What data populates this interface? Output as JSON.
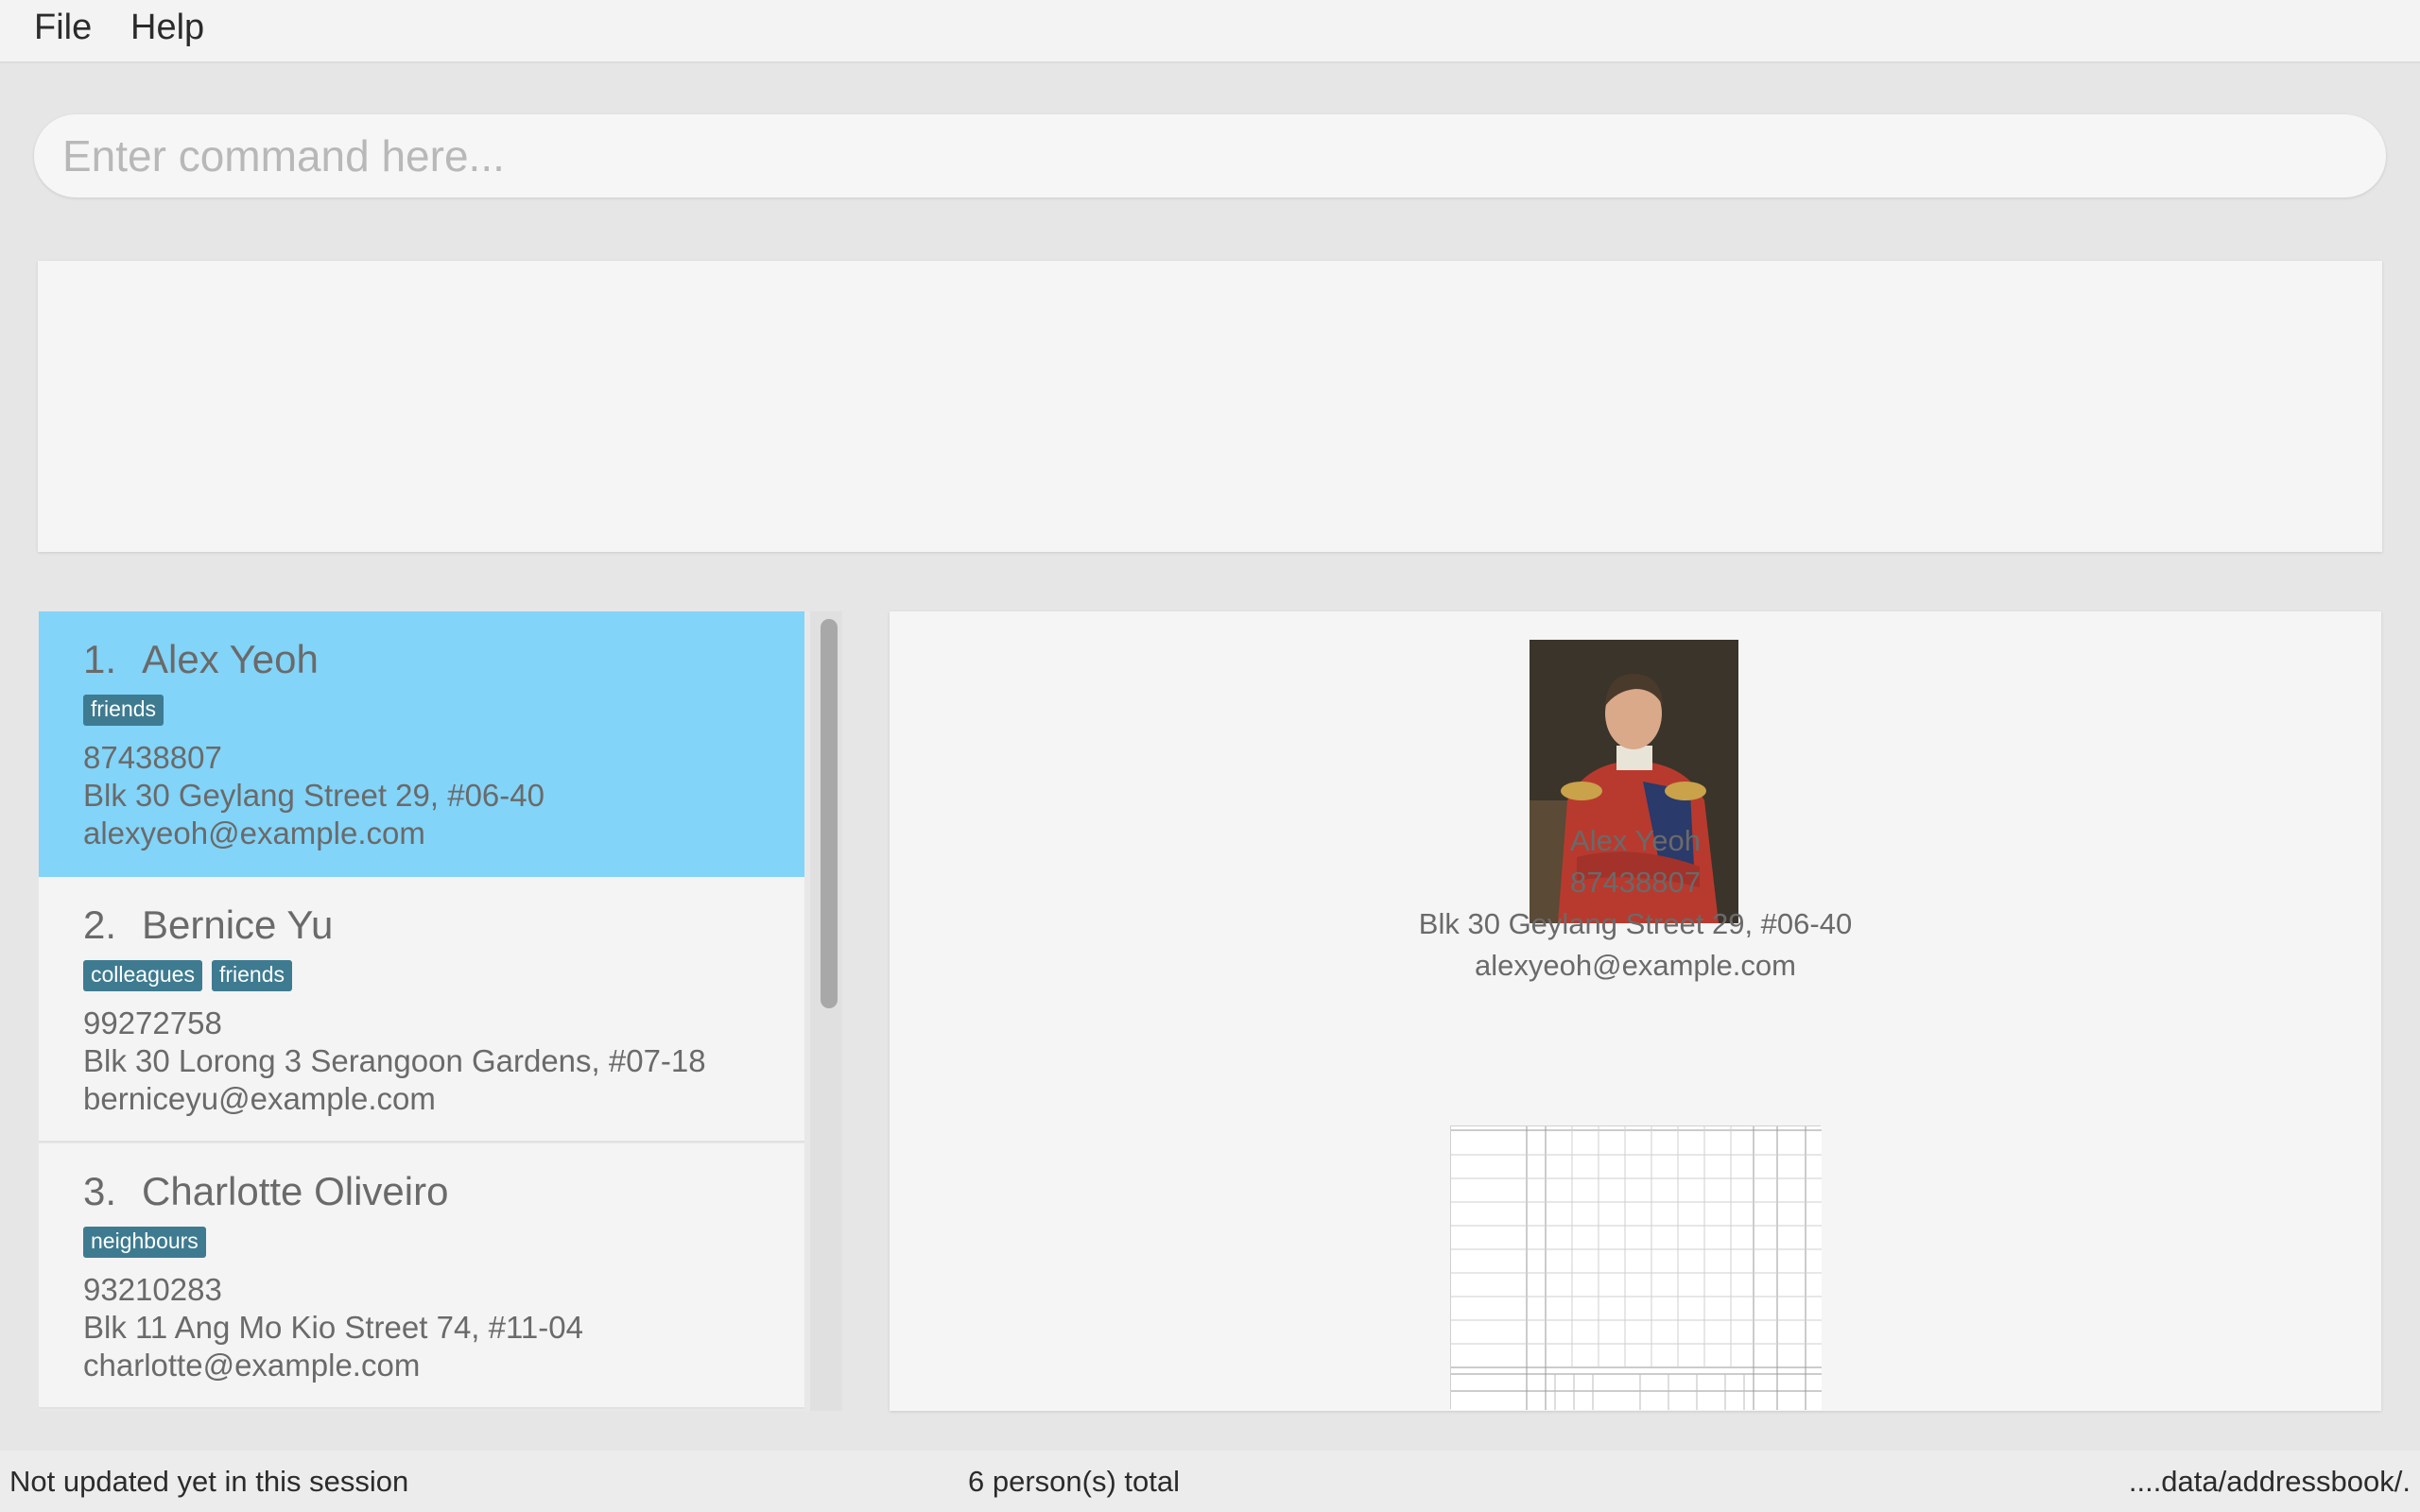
{
  "menu": {
    "file": "File",
    "help": "Help"
  },
  "command": {
    "placeholder": "Enter command here...",
    "value": ""
  },
  "result": {
    "text": ""
  },
  "persons": [
    {
      "index": "1.",
      "name": "Alex Yeoh",
      "tags": [
        "friends"
      ],
      "phone": "87438807",
      "address": "Blk 30 Geylang Street 29, #06-40",
      "email": "alexyeoh@example.com",
      "selected": true
    },
    {
      "index": "2.",
      "name": "Bernice Yu",
      "tags": [
        "colleagues",
        "friends"
      ],
      "phone": "99272758",
      "address": "Blk 30 Lorong 3 Serangoon Gardens, #07-18",
      "email": "berniceyu@example.com",
      "selected": false
    },
    {
      "index": "3.",
      "name": "Charlotte Oliveiro",
      "tags": [
        "neighbours"
      ],
      "phone": "93210283",
      "address": "Blk 11 Ang Mo Kio Street 74, #11-04",
      "email": "charlotte@example.com",
      "selected": false
    }
  ],
  "detail": {
    "name": "Alex Yeoh",
    "phone": "87438807",
    "address": "Blk 30 Geylang Street 29, #06-40",
    "email": "alexyeoh@example.com"
  },
  "status": {
    "sync": "Not updated yet in this session",
    "total": "6 person(s) total",
    "path": "....data/addressbook/."
  },
  "colors": {
    "selected_card": "#82d4f8",
    "tag": "#3e7b91"
  }
}
